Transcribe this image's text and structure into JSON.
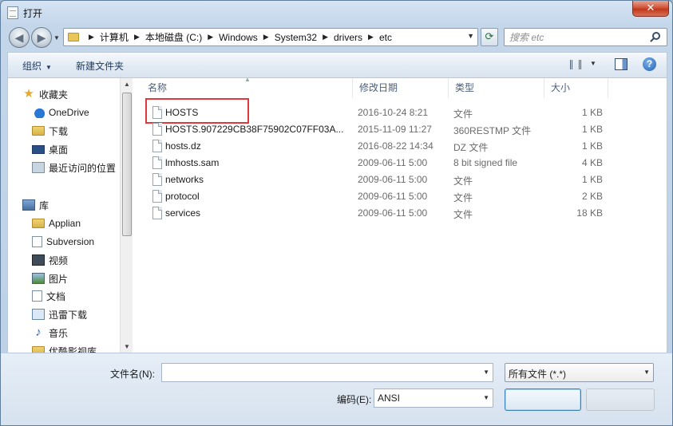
{
  "window": {
    "title": "打开",
    "close_glyph": "✕"
  },
  "nav": {
    "back_glyph": "◀",
    "forward_glyph": "▶"
  },
  "address": {
    "crumbs": [
      "计算机",
      "本地磁盘 (C:)",
      "Windows",
      "System32",
      "drivers",
      "etc"
    ]
  },
  "search": {
    "placeholder": "搜索 etc"
  },
  "toolbar": {
    "organize_label": "组织",
    "new_folder_label": "新建文件夹",
    "help_glyph": "?"
  },
  "sidebar": {
    "items": [
      {
        "label": "收藏夹",
        "icon": "star-icon"
      },
      {
        "label": "OneDrive",
        "icon": "cloud-icon"
      },
      {
        "label": "下载",
        "icon": "folder-icon"
      },
      {
        "label": "桌面",
        "icon": "desktop-icon"
      },
      {
        "label": "最近访问的位置",
        "icon": "recent-places-icon"
      },
      {
        "label": "库",
        "icon": "library-icon"
      },
      {
        "label": "Applian",
        "icon": "folder-icon"
      },
      {
        "label": "Subversion",
        "icon": "document-library-icon"
      },
      {
        "label": "视频",
        "icon": "video-icon"
      },
      {
        "label": "图片",
        "icon": "picture-icon"
      },
      {
        "label": "文档",
        "icon": "document-library-icon"
      },
      {
        "label": "迅雷下载",
        "icon": "download-library-icon"
      },
      {
        "label": "音乐",
        "icon": "music-icon"
      },
      {
        "label": "优酷影视库",
        "icon": "folder-icon"
      }
    ]
  },
  "columns": {
    "name": "名称",
    "date": "修改日期",
    "type": "类型",
    "size": "大小"
  },
  "files": [
    {
      "name": "HOSTS",
      "date": "2016-10-24 8:21",
      "type": "文件",
      "size": "1 KB"
    },
    {
      "name": "HOSTS.907229CB38F75902C07FF03A...",
      "date": "2015-11-09 11:27",
      "type": "360RESTMP 文件",
      "size": "1 KB"
    },
    {
      "name": "hosts.dz",
      "date": "2016-08-22 14:34",
      "type": "DZ 文件",
      "size": "1 KB"
    },
    {
      "name": "lmhosts.sam",
      "date": "2009-06-11 5:00",
      "type": "8 bit signed file",
      "size": "4 KB"
    },
    {
      "name": "networks",
      "date": "2009-06-11 5:00",
      "type": "文件",
      "size": "1 KB"
    },
    {
      "name": "protocol",
      "date": "2009-06-11 5:00",
      "type": "文件",
      "size": "2 KB"
    },
    {
      "name": "services",
      "date": "2009-06-11 5:00",
      "type": "文件",
      "size": "18 KB"
    }
  ],
  "bottom": {
    "filename_label": "文件名(N):",
    "filename_value": "",
    "filter_value": "所有文件 (*.*)",
    "encoding_label": "编码(E):",
    "encoding_value": "ANSI"
  }
}
